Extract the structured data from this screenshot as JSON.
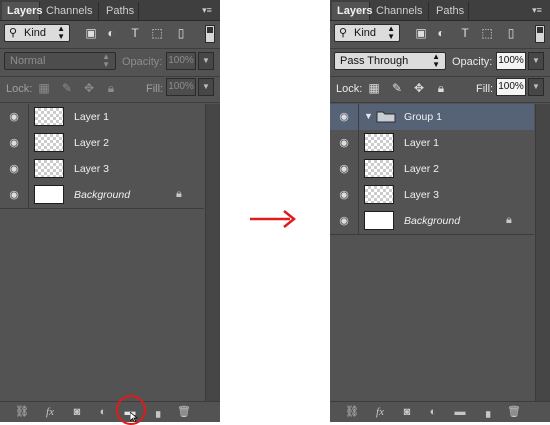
{
  "tabs": [
    "Layers",
    "Channels",
    "Paths"
  ],
  "filter": {
    "kind_label": "Kind"
  },
  "before": {
    "blend_mode": "Normal",
    "opacity_label": "Opacity:",
    "opacity_value": "100%",
    "lock_label": "Lock:",
    "fill_label": "Fill:",
    "fill_value": "100%",
    "layers": [
      {
        "name": "Layer 1",
        "thumb": "transparent"
      },
      {
        "name": "Layer 2",
        "thumb": "transparent"
      },
      {
        "name": "Layer 3",
        "thumb": "transparent"
      },
      {
        "name": "Background",
        "thumb": "white",
        "locked": true
      }
    ]
  },
  "after": {
    "blend_mode": "Pass Through",
    "opacity_label": "Opacity:",
    "opacity_value": "100%",
    "lock_label": "Lock:",
    "fill_label": "Fill:",
    "fill_value": "100%",
    "group_name": "Group 1",
    "layers": [
      {
        "name": "Layer 1",
        "thumb": "transparent"
      },
      {
        "name": "Layer 2",
        "thumb": "transparent"
      },
      {
        "name": "Layer 3",
        "thumb": "transparent"
      },
      {
        "name": "Background",
        "thumb": "white",
        "locked": true
      }
    ]
  },
  "colors": {
    "panel_bg": "#535353",
    "selected_group_bg": "#566376",
    "highlight_red": "#e01b1b"
  },
  "icons": {
    "bottom_bar": [
      "link-layers-icon",
      "fx-icon",
      "layer-mask-icon",
      "adjustment-layer-icon",
      "new-group-icon",
      "new-layer-icon",
      "trash-icon"
    ]
  }
}
